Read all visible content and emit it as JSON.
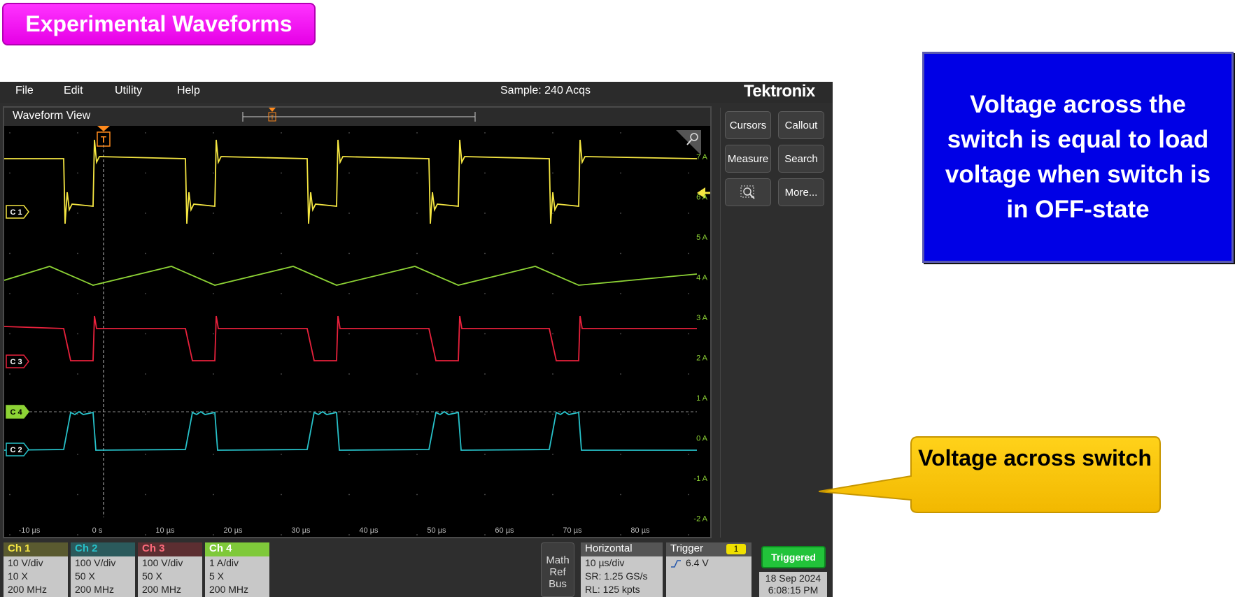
{
  "slide_title": "Experimental Waveforms",
  "menubar": {
    "items": [
      "File",
      "Edit",
      "Utility",
      "Help"
    ],
    "sample": "Sample: 240 Acqs",
    "brand": "Tektronix"
  },
  "waveform_view": {
    "title": "Waveform View",
    "trigger_marker": "T",
    "time_labels": [
      "-10 µs",
      "0 s",
      "10 µs",
      "20 µs",
      "30 µs",
      "40 µs",
      "50 µs",
      "60 µs",
      "70 µs",
      "80 µs"
    ],
    "amp_labels": [
      "7 A",
      "6 A",
      "5 A",
      "4 A",
      "3 A",
      "2 A",
      "1 A",
      "0 A",
      "-1 A",
      "-2 A"
    ],
    "channel_tags": [
      {
        "label": "C 1",
        "color": "#f5e642"
      },
      {
        "label": "C 3",
        "color": "#e8213c"
      },
      {
        "label": "C 4",
        "color": "#8dd335"
      },
      {
        "label": "C 2",
        "color": "#27c1c9"
      }
    ]
  },
  "side_panel": {
    "buttons": [
      "Cursors",
      "Callout",
      "Measure",
      "Search",
      "More..."
    ]
  },
  "channels": [
    {
      "name": "Ch 1",
      "color": "#5a5a30",
      "lines": [
        "10 V/div",
        "10 X",
        "200 MHz"
      ]
    },
    {
      "name": "Ch 2",
      "color": "#2b5a5c",
      "lines": [
        "100 V/div",
        "50 X",
        "200 MHz"
      ]
    },
    {
      "name": "Ch 3",
      "color": "#5c2e31",
      "lines": [
        "100 V/div",
        "50 X",
        "200 MHz"
      ]
    },
    {
      "name": "Ch 4",
      "color": "#7fc93a",
      "lines": [
        "1 A/div",
        "5 X",
        "200 MHz"
      ]
    }
  ],
  "math_ref_bus": [
    "Math",
    "Ref",
    "Bus"
  ],
  "horizontal": {
    "title": "Horizontal",
    "lines": [
      "10 µs/div",
      "SR: 1.25 GS/s",
      "RL: 125 kpts"
    ]
  },
  "trigger": {
    "title": "Trigger",
    "badge": "1",
    "level": "6.4 V"
  },
  "status": "Triggered",
  "date": "18 Sep 2024",
  "time": "6:08:15 PM",
  "notes": {
    "blue": "Voltage across the switch is equal to load voltage when switch is in OFF-state",
    "callout": "Voltage across switch"
  }
}
